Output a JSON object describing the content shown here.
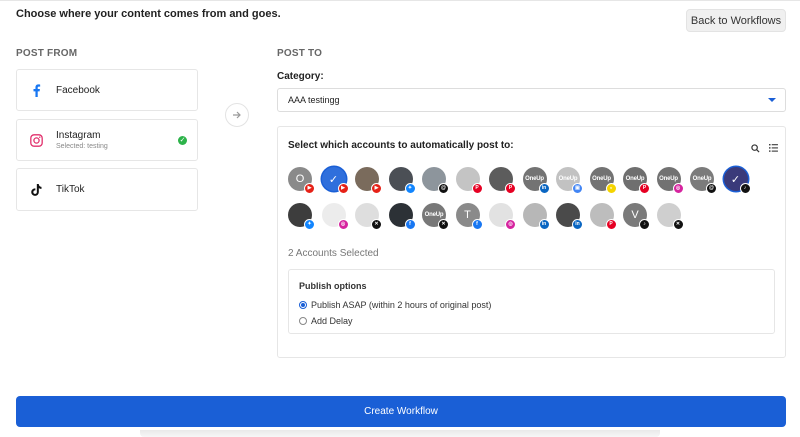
{
  "header": {
    "instruction": "Choose where your content comes from and goes.",
    "back_label": "Back to Workflows"
  },
  "post_from": {
    "title": "POST FROM",
    "sources": [
      {
        "name": "Facebook",
        "icon": "facebook-icon"
      },
      {
        "name": "Instagram",
        "sub": "Selected: testing",
        "icon": "instagram-icon",
        "selected": true
      },
      {
        "name": "TikTok",
        "icon": "tiktok-icon"
      }
    ]
  },
  "post_to": {
    "title": "POST TO",
    "category_label": "Category:",
    "category_value": "AAA testingg",
    "accounts_title": "Select which accounts to automatically post to:",
    "selected_count": "2 Accounts Selected",
    "accounts": [
      {
        "initial": "O",
        "bg": "#8a8a8a",
        "badge": "youtube"
      },
      {
        "initial": "✓",
        "bg": "#2f6fdc",
        "badge": "youtube",
        "selected": true
      },
      {
        "initial": "",
        "bg": "#7a6b5c",
        "badge": "youtube"
      },
      {
        "initial": "",
        "bg": "#4b4f55",
        "badge": "bluesky"
      },
      {
        "initial": "",
        "bg": "#8d959c",
        "badge": "threads"
      },
      {
        "initial": "",
        "bg": "#c4c4c4",
        "badge": "pinterest"
      },
      {
        "initial": "",
        "bg": "#5c5c5c",
        "badge": "pinterest"
      },
      {
        "initial": "OneUp",
        "bg": "#737373",
        "badge": "linkedin"
      },
      {
        "initial": "OneUp",
        "bg": "#c2c2c2",
        "badge": "gbusiness"
      },
      {
        "initial": "OneUp",
        "bg": "#737373",
        "badge": "snapchat"
      },
      {
        "initial": "OneUp",
        "bg": "#6f6f6f",
        "badge": "pinterest"
      },
      {
        "initial": "OneUp",
        "bg": "#727272",
        "badge": "instagram"
      },
      {
        "initial": "OneUp",
        "bg": "#7b7b7b",
        "badge": "threads"
      },
      {
        "initial": "✓",
        "bg": "#3a3a7a",
        "badge": "tiktok",
        "selected": true
      },
      {
        "initial": "",
        "bg": "#3d3d3d",
        "badge": "bluesky"
      },
      {
        "initial": "",
        "bg": "#ececec",
        "badge": "instagram"
      },
      {
        "initial": "",
        "bg": "#dedede",
        "badge": "twitter"
      },
      {
        "initial": "",
        "bg": "#2c3136",
        "badge": "facebook"
      },
      {
        "initial": "OneUp",
        "bg": "#787878",
        "badge": "twitter"
      },
      {
        "initial": "T",
        "bg": "#8a8a8a",
        "badge": "facebook"
      },
      {
        "initial": "",
        "bg": "#e2e2e2",
        "badge": "instagram"
      },
      {
        "initial": "",
        "bg": "#b7b7b7",
        "badge": "linkedin"
      },
      {
        "initial": "",
        "bg": "#4a4a4a",
        "badge": "linkedin"
      },
      {
        "initial": "",
        "bg": "#bdbdbd",
        "badge": "pinterest"
      },
      {
        "initial": "V",
        "bg": "#7a7a7a",
        "badge": "tiktok"
      },
      {
        "initial": "",
        "bg": "#cfcfcf",
        "badge": "twitter"
      }
    ],
    "publish": {
      "title": "Publish options",
      "options": [
        {
          "label": "Publish ASAP (within 2 hours of original post)",
          "checked": true
        },
        {
          "label": "Add Delay",
          "checked": false
        }
      ]
    }
  },
  "create_label": "Create Workflow",
  "colors": {
    "accent": "#1a5fd6",
    "check": "#2db34a",
    "badges": {
      "youtube": "#e62117",
      "bluesky": "#1185fe",
      "threads": "#111111",
      "pinterest": "#e60023",
      "linkedin": "#0a66c2",
      "gbusiness": "#4285f4",
      "snapchat": "#f5d400",
      "instagram": "#d6249f",
      "tiktok": "#111111",
      "twitter": "#111111",
      "facebook": "#1877f2"
    }
  }
}
